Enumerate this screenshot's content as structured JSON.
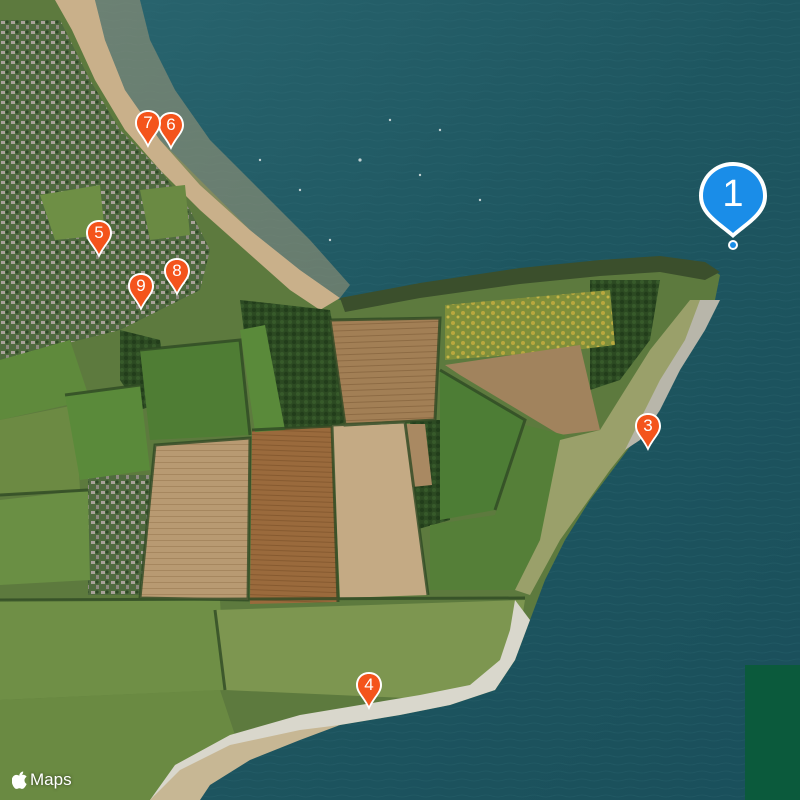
{
  "map": {
    "type": "satellite",
    "attribution": "Maps",
    "apple_logo_icon": "apple-logo-icon"
  },
  "colors": {
    "sea": "#1d5660",
    "pin_orange": "#f4541c",
    "pin_blue": "#1a8de8",
    "block_green": "#0b5a3c"
  },
  "markers": [
    {
      "id": "1",
      "label": "1",
      "style": "selected"
    },
    {
      "id": "3",
      "label": "3",
      "style": "normal"
    },
    {
      "id": "4",
      "label": "4",
      "style": "normal"
    },
    {
      "id": "5",
      "label": "5",
      "style": "normal"
    },
    {
      "id": "6",
      "label": "6",
      "style": "normal"
    },
    {
      "id": "7",
      "label": "7",
      "style": "normal"
    },
    {
      "id": "8",
      "label": "8",
      "style": "normal"
    },
    {
      "id": "9",
      "label": "9",
      "style": "normal"
    }
  ]
}
